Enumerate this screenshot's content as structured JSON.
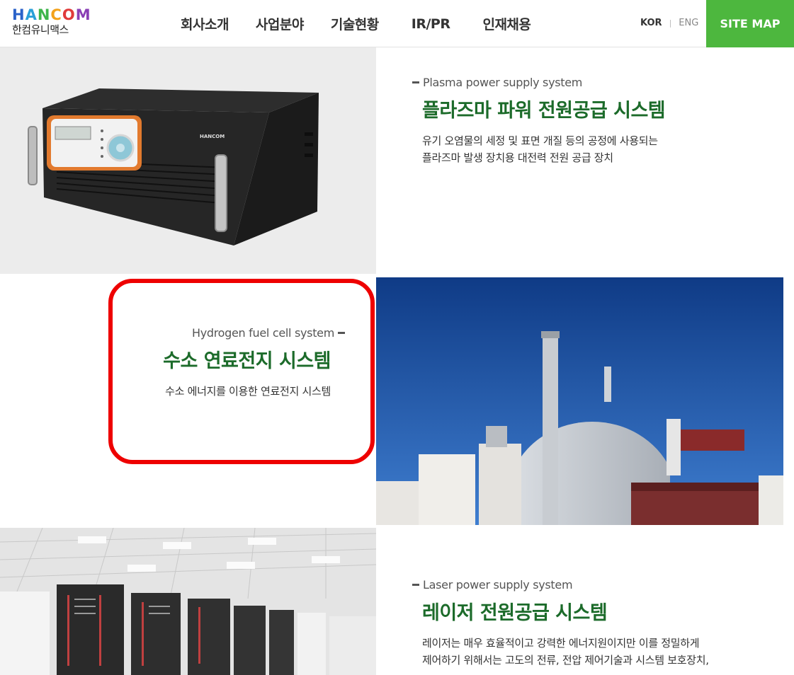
{
  "header": {
    "logo_text": "HANCOM",
    "logo_sub": "한컴유니맥스",
    "nav": [
      "회사소개",
      "사업분야",
      "기술현황",
      "IR/PR",
      "인재채용"
    ],
    "lang_kor": "KOR",
    "lang_eng": "ENG",
    "sitemap": "SITE MAP"
  },
  "sections": [
    {
      "eng": "Plasma power supply system",
      "title": "플라즈마 파워 전원공급 시스템",
      "desc_lines": [
        "유기 오염물의 세정 및 표면 개질 등의 공정에 사용되는",
        "플라즈마 발생 장치용 대전력 전원 공급 장치"
      ]
    },
    {
      "eng": "Hydrogen fuel cell system",
      "title": "수소 연료전지 시스템",
      "desc_lines": [
        "수소 에너지를 이용한 연료전지 시스템"
      ]
    },
    {
      "eng": "Laser power supply system",
      "title": "레이저 전원공급 시스템",
      "desc_lines": [
        "레이저는 매우 효율적이고 강력한 에너지원이지만 이를 정밀하게",
        "제어하기 위해서는 고도의 전류, 전압 제어기술과 시스템 보호장치,"
      ]
    }
  ],
  "device_brand": "HANCOM",
  "colors": {
    "accent_green": "#4db73e",
    "title_green": "#1c6b2a",
    "highlight_red": "#ee0000"
  }
}
